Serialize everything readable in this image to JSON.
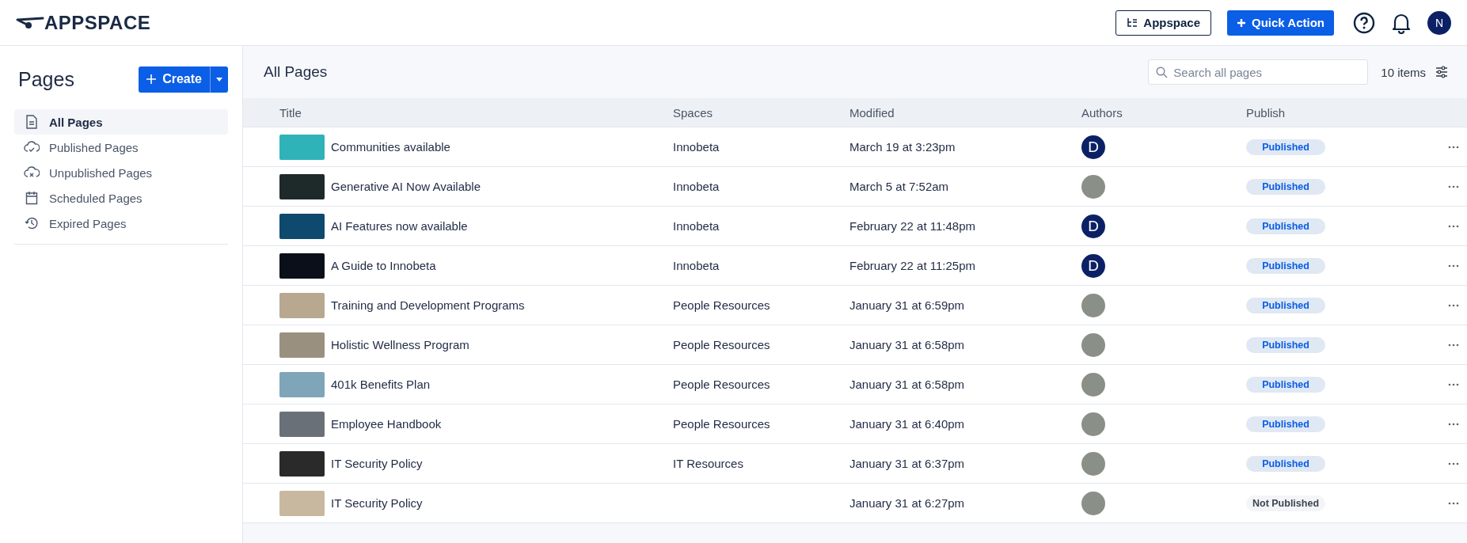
{
  "header": {
    "logo": "APPSPACE",
    "switch_button": "Appspace",
    "quick_action": "Quick Action",
    "user_initial": "N"
  },
  "sidebar": {
    "title": "Pages",
    "create_button": "Create",
    "items": [
      {
        "label": "All Pages",
        "selected": true
      },
      {
        "label": "Published Pages",
        "selected": false
      },
      {
        "label": "Unpublished Pages",
        "selected": false
      },
      {
        "label": "Scheduled Pages",
        "selected": false
      },
      {
        "label": "Expired Pages",
        "selected": false
      }
    ]
  },
  "main": {
    "title": "All Pages",
    "search": {
      "placeholder": "Search all pages"
    },
    "count": "10 items"
  },
  "table": {
    "columns": [
      "Title",
      "Spaces",
      "Modified",
      "Authors",
      "Publish"
    ],
    "rows": [
      {
        "title": "Communities available",
        "space": "Innobeta",
        "modified": "March 19 at 3:23pm",
        "author": {
          "kind": "initial",
          "initial": "D"
        },
        "published": true,
        "status": "Published"
      },
      {
        "title": "Generative AI Now Available",
        "space": "Innobeta",
        "modified": "March 5 at 7:52am",
        "author": {
          "kind": "photo"
        },
        "published": true,
        "status": "Published"
      },
      {
        "title": "AI Features now available",
        "space": "Innobeta",
        "modified": "February 22 at 11:48pm",
        "author": {
          "kind": "initial",
          "initial": "D"
        },
        "published": true,
        "status": "Published"
      },
      {
        "title": "A Guide to Innobeta",
        "space": "Innobeta",
        "modified": "February 22 at 11:25pm",
        "author": {
          "kind": "initial",
          "initial": "D"
        },
        "published": true,
        "status": "Published"
      },
      {
        "title": "Training and Development Programs",
        "space": "People Resources",
        "modified": "January 31 at 6:59pm",
        "author": {
          "kind": "photo"
        },
        "published": true,
        "status": "Published"
      },
      {
        "title": "Holistic Wellness Program",
        "space": "People Resources",
        "modified": "January 31 at 6:58pm",
        "author": {
          "kind": "photo"
        },
        "published": true,
        "status": "Published"
      },
      {
        "title": "401k Benefits Plan",
        "space": "People Resources",
        "modified": "January 31 at 6:58pm",
        "author": {
          "kind": "photo"
        },
        "published": true,
        "status": "Published"
      },
      {
        "title": "Employee Handbook",
        "space": "People Resources",
        "modified": "January 31 at 6:40pm",
        "author": {
          "kind": "photo"
        },
        "published": true,
        "status": "Published"
      },
      {
        "title": "IT Security Policy",
        "space": "IT Resources",
        "modified": "January 31 at 6:37pm",
        "author": {
          "kind": "photo"
        },
        "published": true,
        "status": "Published"
      },
      {
        "title": "IT Security Policy",
        "space": "",
        "modified": "January 31 at 6:27pm",
        "author": {
          "kind": "photo"
        },
        "published": false,
        "status": "Not Published"
      }
    ]
  }
}
